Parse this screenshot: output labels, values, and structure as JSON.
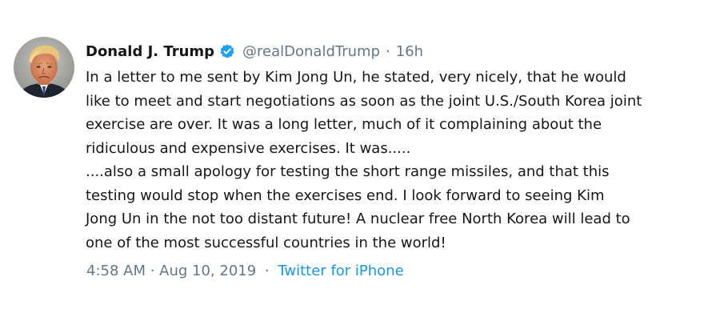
{
  "tweet": {
    "display_name": "Donald J. Trump",
    "handle": "@realDonaldTrump",
    "separator": "·",
    "relative_time": "16h",
    "verified_icon": "verified-badge-icon",
    "avatar_icon": "profile-photo",
    "text_lines": [
      "In a letter to me sent by Kim Jong Un, he stated, very nicely, that he would",
      "like to meet and start negotiations as soon as the joint U.S./South Korea joint",
      "exercise are over. It was a long letter, much of it complaining about the",
      "ridiculous and expensive exercises. It was.....",
      "....also a small apology for testing the short range missiles, and that this",
      "testing would stop when the exercises end. I look forward to seeing Kim",
      "Jong Un in the not too distant future! A nuclear free North Korea will lead to",
      "one of the most successful countries in the world!"
    ],
    "footer": {
      "timestamp": "4:58 AM · Aug 10, 2019",
      "separator": "·",
      "source": "Twitter for iPhone"
    }
  },
  "colors": {
    "text": "#14171a",
    "muted": "#657786",
    "link": "#1b95e0",
    "verified": "#1da1f2"
  }
}
